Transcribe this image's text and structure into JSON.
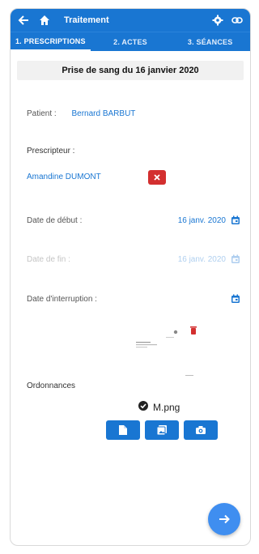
{
  "header": {
    "title": "Traitement"
  },
  "tabs": [
    {
      "label": "1. PRESCRIPTIONS",
      "active": true
    },
    {
      "label": "2. ACTES",
      "active": false
    },
    {
      "label": "3. SÉANCES",
      "active": false
    }
  ],
  "subheader": "Prise de sang du 16 janvier 2020",
  "patient": {
    "label": "Patient :",
    "value": "Bernard BARBUT"
  },
  "prescripteur": {
    "label": "Prescripteur :",
    "value": "Amandine DUMONT"
  },
  "date_debut": {
    "label": "Date de début :",
    "value": "16 janv. 2020"
  },
  "date_fin": {
    "label": "Date de fin :",
    "value": "16 janv. 2020"
  },
  "date_interruption": {
    "label": "Date d'interruption :",
    "value": ""
  },
  "ordonnances": {
    "label": "Ordonnances",
    "file_name": "M.png"
  },
  "colors": {
    "primary": "#1976d2",
    "danger": "#d32f2f",
    "fab": "#3f8ef0"
  }
}
